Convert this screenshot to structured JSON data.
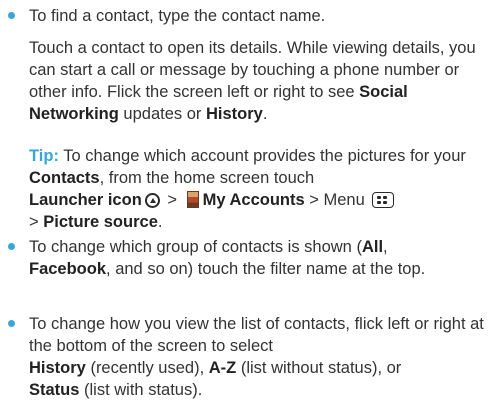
{
  "bullets": [
    {
      "text": "To find a contact, type the contact name."
    },
    {
      "p1": "To change which group of contacts is shown (",
      "b1": "All",
      "p2": ",",
      "b2": "Facebook",
      "p3": ", and so on) touch the filter name at the top."
    },
    {
      "p1": "To change how you view the list of contacts, flick left or right at the bottom of the screen to select",
      "b1": "History",
      "p2": " (recently used), ",
      "b2": "A-Z",
      "p3": " (list without status), or",
      "b3": "Status",
      "p4": " (list with status)."
    }
  ],
  "details": {
    "p1": "Touch a contact to open its details. While viewing details, you can start a call or message by touching a phone number or other info. Flick the screen left or right to see ",
    "b1": "Social Networking",
    "p2": " updates or ",
    "b2": "History",
    "p3": "."
  },
  "tip": {
    "label": "Tip:",
    "p1": " To change which account provides the pictures for your ",
    "b1": "Contacts",
    "p2": ", from the home screen touch",
    "b2": "Launcher icon",
    "p3": " > ",
    "b3": "My Accounts",
    "p4": " > Menu ",
    "p5": "> ",
    "b4": "Picture source",
    "p6": "."
  },
  "icons": {
    "bullet_color": "#3aa6d8",
    "launcher": "launcher-icon",
    "accounts": "my-accounts-icon",
    "menu": "menu-icon"
  }
}
